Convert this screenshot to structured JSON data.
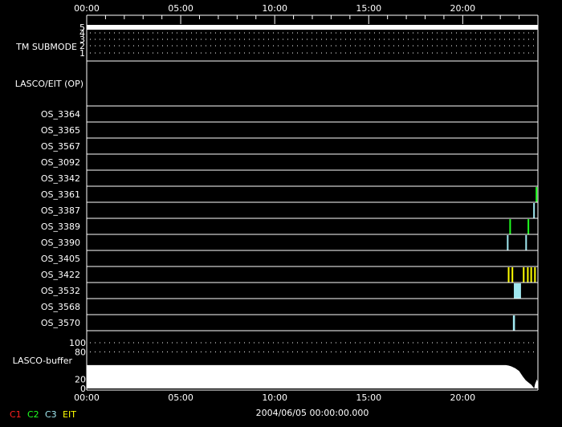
{
  "chart_data": {
    "type": "timeline",
    "title": "",
    "xlabel": "2004/06/05 00:00:00.000",
    "xlim_hours": [
      0,
      24
    ],
    "x_ticks": [
      "00:00",
      "05:00",
      "10:00",
      "15:00",
      "20:00"
    ],
    "tm_submode": {
      "label": "TM SUBMODE",
      "levels": [
        "5",
        "4",
        "3",
        "2",
        "1"
      ],
      "value": 5
    },
    "lasco_eit_label": "LASCO/EIT (OP)",
    "rows": [
      {
        "name": "OS_3364",
        "events": []
      },
      {
        "name": "OS_3365",
        "events": []
      },
      {
        "name": "OS_3567",
        "events": []
      },
      {
        "name": "OS_3092",
        "events": []
      },
      {
        "name": "OS_3342",
        "events": []
      },
      {
        "name": "OS_3361",
        "events": [
          {
            "start": 23.88,
            "end": 23.95,
            "instrument": "C2"
          }
        ]
      },
      {
        "name": "OS_3387",
        "events": [
          {
            "start": 23.75,
            "end": 23.82,
            "instrument": "C3"
          }
        ]
      },
      {
        "name": "OS_3389",
        "events": [
          {
            "start": 22.48,
            "end": 22.55,
            "instrument": "C2"
          },
          {
            "start": 23.45,
            "end": 23.52,
            "instrument": "C2"
          }
        ]
      },
      {
        "name": "OS_3390",
        "events": [
          {
            "start": 22.35,
            "end": 22.42,
            "instrument": "C3"
          },
          {
            "start": 23.33,
            "end": 23.4,
            "instrument": "C3"
          }
        ]
      },
      {
        "name": "OS_3405",
        "events": []
      },
      {
        "name": "OS_3422",
        "events": [
          {
            "start": 22.4,
            "end": 22.44,
            "instrument": "EIT"
          },
          {
            "start": 22.6,
            "end": 22.64,
            "instrument": "EIT"
          },
          {
            "start": 23.2,
            "end": 23.24,
            "instrument": "EIT"
          },
          {
            "start": 23.42,
            "end": 23.46,
            "instrument": "EIT"
          },
          {
            "start": 23.6,
            "end": 23.64,
            "instrument": "EIT"
          },
          {
            "start": 23.8,
            "end": 23.84,
            "instrument": "EIT"
          }
        ]
      },
      {
        "name": "OS_3532",
        "events": [
          {
            "start": 22.72,
            "end": 23.1,
            "instrument": "C3"
          }
        ]
      },
      {
        "name": "OS_3568",
        "events": []
      },
      {
        "name": "OS_3570",
        "events": [
          {
            "start": 22.67,
            "end": 22.78,
            "instrument": "C3"
          }
        ]
      }
    ],
    "buffer": {
      "label": "LASCO-buffer",
      "y_ticks": [
        "100",
        "80",
        "20",
        "0"
      ],
      "ylim": [
        0,
        100
      ],
      "series": [
        [
          0,
          51
        ],
        [
          22.3,
          51
        ],
        [
          22.45,
          50
        ],
        [
          22.6,
          48
        ],
        [
          22.8,
          44
        ],
        [
          23.0,
          38
        ],
        [
          23.2,
          26
        ],
        [
          23.35,
          18
        ],
        [
          23.5,
          13
        ],
        [
          23.65,
          8
        ],
        [
          23.75,
          3
        ],
        [
          23.8,
          0
        ],
        [
          23.85,
          10
        ],
        [
          23.95,
          20
        ],
        [
          24,
          12
        ]
      ]
    },
    "legend": [
      {
        "name": "C1",
        "color": "#ff2020"
      },
      {
        "name": "C2",
        "color": "#20ff20"
      },
      {
        "name": "C3",
        "color": "#a0e8f0"
      },
      {
        "name": "EIT",
        "color": "#ffff00"
      }
    ]
  }
}
